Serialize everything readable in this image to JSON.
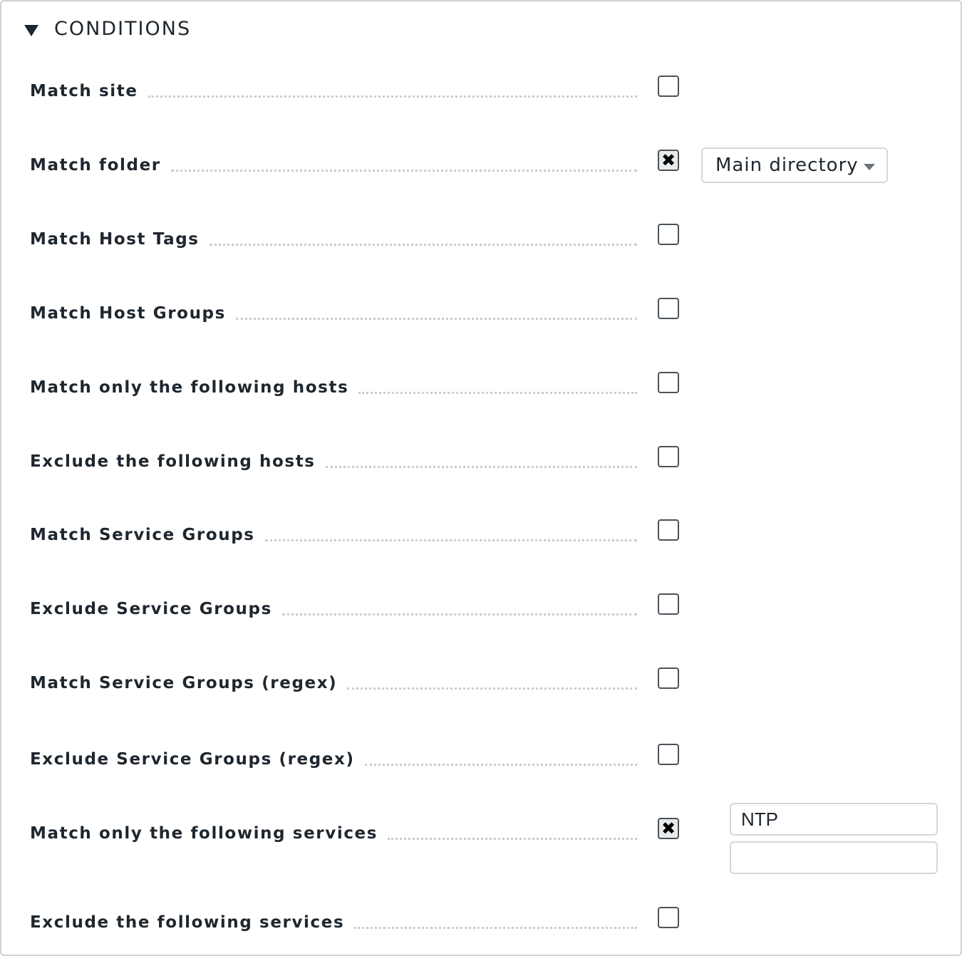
{
  "section": {
    "title": "CONDITIONS",
    "expanded_icon": "triangle-down-icon"
  },
  "conditions": [
    {
      "label": "Match site",
      "checked": false
    },
    {
      "label": "Match folder",
      "checked": true
    },
    {
      "label": "Match Host Tags",
      "checked": false
    },
    {
      "label": "Match Host Groups",
      "checked": false
    },
    {
      "label": "Match only the following hosts",
      "checked": false
    },
    {
      "label": "Exclude the following hosts",
      "checked": false
    },
    {
      "label": "Match Service Groups",
      "checked": false
    },
    {
      "label": "Exclude Service Groups",
      "checked": false
    },
    {
      "label": "Match Service Groups (regex)",
      "checked": false
    },
    {
      "label": "Exclude Service Groups (regex)",
      "checked": false
    },
    {
      "label": "Match only the following services",
      "checked": true
    },
    {
      "label": "Exclude the following services",
      "checked": false
    }
  ],
  "folder_select": {
    "value": "Main directory"
  },
  "services_inputs": {
    "first_value": "NTP",
    "second_value": ""
  },
  "checkbox_mark": "✖"
}
